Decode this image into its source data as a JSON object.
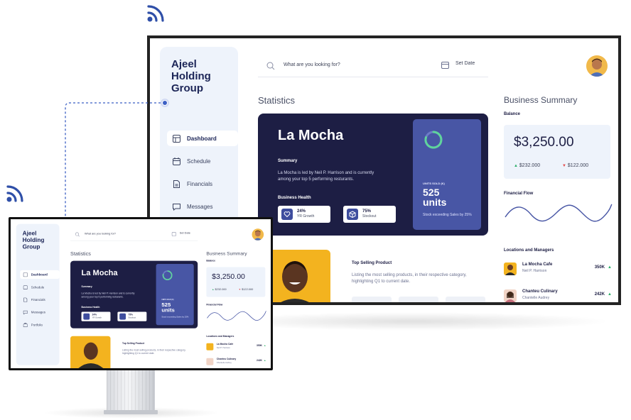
{
  "app": {
    "brand": "Ajeel Holding Group",
    "nav": [
      {
        "label": "Dashboard",
        "icon": "dashboard-icon",
        "active": true
      },
      {
        "label": "Schedule",
        "icon": "calendar-icon",
        "active": false
      },
      {
        "label": "Financials",
        "icon": "document-icon",
        "active": false
      },
      {
        "label": "Messages",
        "icon": "chat-icon",
        "active": false
      },
      {
        "label": "Portfolio",
        "icon": "briefcase-icon",
        "active": false
      }
    ],
    "search": {
      "placeholder": "What are you looking for?"
    },
    "date_button": "Set Date",
    "statistics_title": "Statistics",
    "hero": {
      "title": "La Mocha",
      "summary_label": "Summary",
      "summary": "La Mocha is led by Neil P. Harrison and is currently among your top 5 performing resturants.",
      "health_label": "Business Health",
      "metrics": [
        {
          "value": "24%",
          "label": "YR Growth",
          "icon": "shield-heart-icon"
        },
        {
          "value": "75%",
          "label": "Stockout",
          "icon": "box-icon"
        }
      ],
      "units_label": "UNITS SOLD (K)",
      "units_value": "525",
      "units_unit": "units",
      "units_note": "Stock exceeding Sales by 25%"
    },
    "top_selling": {
      "title": "Top Selling Product",
      "description": "Listing the most selling products, in their respective category, highlighting Q1 to current date."
    },
    "business_summary": {
      "title": "Business Summary",
      "balance_label": "Balance",
      "balance": "$3,250.00",
      "up": "$232.000",
      "down": "$122.000",
      "flow_label": "Financial Flow",
      "locations_label": "Locations and Managers",
      "locations": [
        {
          "name": "La Mocha Cafe",
          "manager": "Neil P. Harrison",
          "value": "350K"
        },
        {
          "name": "Chanteu Culinary",
          "manager": "Chantelle Audrey",
          "value": "242K"
        }
      ]
    },
    "colors": {
      "navy": "#1d1e44",
      "indigo": "#4856a5",
      "accent_yellow": "#f3b31f",
      "up": "#2eaf69",
      "down": "#e34a4a"
    }
  }
}
